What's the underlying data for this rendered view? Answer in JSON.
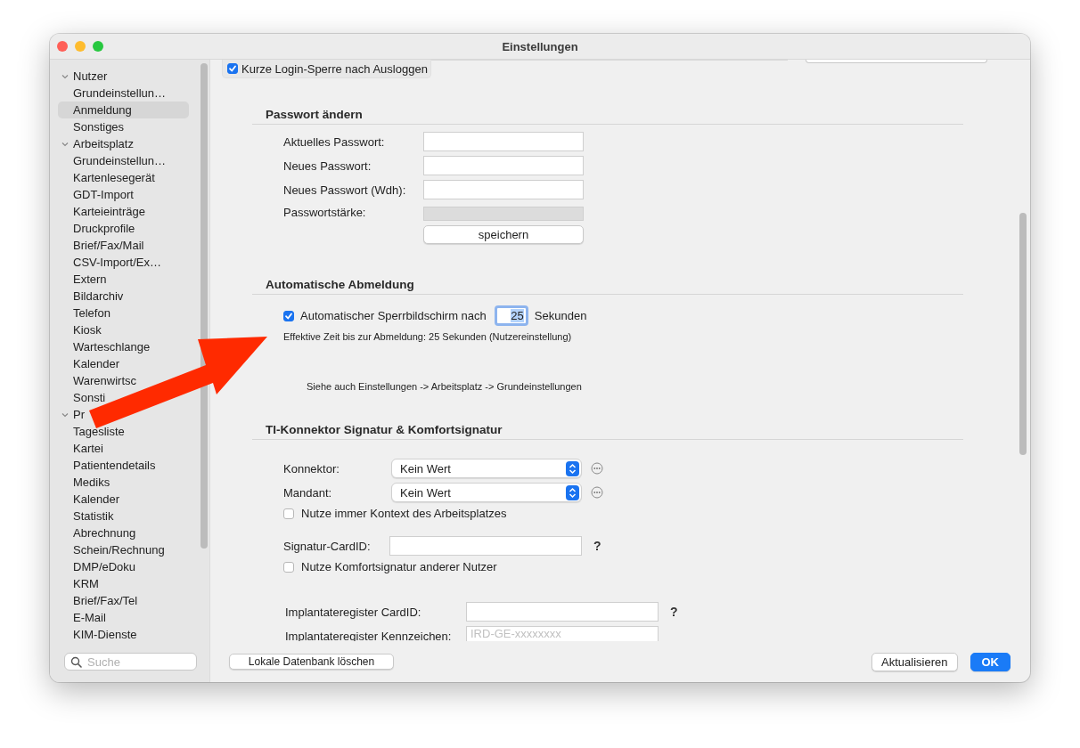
{
  "window": {
    "title": "Einstellungen"
  },
  "sidebar": {
    "items": [
      {
        "label": "Nutzer",
        "expanded": true,
        "selected": false,
        "children": [
          {
            "label": "Grundeinstellun…",
            "selected": false
          },
          {
            "label": "Anmeldung",
            "selected": true
          },
          {
            "label": "Sonstiges",
            "selected": false
          }
        ]
      },
      {
        "label": "Arbeitsplatz",
        "expanded": true,
        "selected": false,
        "children": [
          {
            "label": "Grundeinstellun…",
            "selected": false
          },
          {
            "label": "Kartenlesegerät",
            "selected": false
          },
          {
            "label": "GDT-Import",
            "selected": false
          },
          {
            "label": "Karteieinträge",
            "selected": false
          },
          {
            "label": "Druckprofile",
            "selected": false
          },
          {
            "label": "Brief/Fax/Mail",
            "selected": false
          },
          {
            "label": "CSV-Import/Ex…",
            "selected": false
          },
          {
            "label": "Extern",
            "selected": false
          },
          {
            "label": "Bildarchiv",
            "selected": false
          },
          {
            "label": "Telefon",
            "selected": false
          },
          {
            "label": "Kiosk",
            "selected": false
          },
          {
            "label": "Warteschlange",
            "selected": false
          },
          {
            "label": "Kalender",
            "selected": false
          },
          {
            "label": "Warenwirtsc",
            "selected": false
          },
          {
            "label": "Sonsti",
            "selected": false
          }
        ]
      },
      {
        "label": "Pr",
        "expanded": true,
        "selected": false,
        "children": [
          {
            "label": "Tagesliste",
            "selected": false
          },
          {
            "label": "Kartei",
            "selected": false
          },
          {
            "label": "Patientendetails",
            "selected": false
          },
          {
            "label": "Mediks",
            "selected": false
          },
          {
            "label": "Kalender",
            "selected": false
          },
          {
            "label": "Statistik",
            "selected": false
          },
          {
            "label": "Abrechnung",
            "selected": false
          },
          {
            "label": "Schein/Rechnung",
            "selected": false
          },
          {
            "label": "DMP/eDoku",
            "selected": false
          },
          {
            "label": "KRM",
            "selected": false
          },
          {
            "label": "Brief/Fax/Tel",
            "selected": false
          },
          {
            "label": "E-Mail",
            "selected": false
          },
          {
            "label": "KIM-Dienste",
            "selected": false
          }
        ]
      }
    ],
    "search": {
      "placeholder": "Suche"
    }
  },
  "top_option": {
    "label": "Kurze Login-Sperre nach Ausloggen",
    "checked": true
  },
  "password_section": {
    "title": "Passwort ändern",
    "fields": [
      {
        "label": "Aktuelles Passwort:"
      },
      {
        "label": "Neues Passwort:"
      },
      {
        "label": "Neues Passwort (Wdh):"
      }
    ],
    "strength": {
      "label": "Passwortstärke:",
      "level": 0
    },
    "save_button": "speichern"
  },
  "auto_logout": {
    "title": "Automatische Abmeldung",
    "checkbox": {
      "label": "Automatischer Sperrbildschirm nach",
      "checked": true
    },
    "seconds": "25",
    "unit": "Sekunden",
    "effective_note": "Effektive Zeit bis zur Abmeldung: 25 Sekunden (Nutzereinstellung)",
    "see_also": "Siehe auch Einstellungen -> Arbeitsplatz -> Grundeinstellungen"
  },
  "ti_section": {
    "title": "TI-Konnektor Signatur & Komfortsignatur",
    "groups": [
      {
        "rows": [
          {
            "kind": "select",
            "label": "Konnektor:",
            "value": "Kein Wert"
          },
          {
            "kind": "select",
            "label": "Mandant:",
            "value": "Kein Wert"
          },
          {
            "kind": "checkbox",
            "label": "Nutze immer Kontext des Arbeitsplatzes",
            "checked": false
          }
        ]
      },
      {
        "rows": [
          {
            "kind": "text",
            "label": "Signatur-CardID:",
            "help": "?"
          },
          {
            "kind": "checkbox",
            "label": "Nutze Komfortsignatur anderer Nutzer",
            "checked": false
          }
        ]
      },
      {
        "rows": [
          {
            "kind": "text",
            "label": "Implantateregister CardID:",
            "help": "?"
          },
          {
            "kind": "text",
            "label": "Implantateregister Kennzeichen:",
            "placeholder": "IRD-GE-xxxxxxxx"
          }
        ]
      }
    ]
  },
  "footer": {
    "left_button": "Lokale Datenbank löschen",
    "buttons": [
      {
        "label": "Aktualisieren",
        "default": false
      },
      {
        "label": "OK",
        "default": true
      }
    ]
  }
}
